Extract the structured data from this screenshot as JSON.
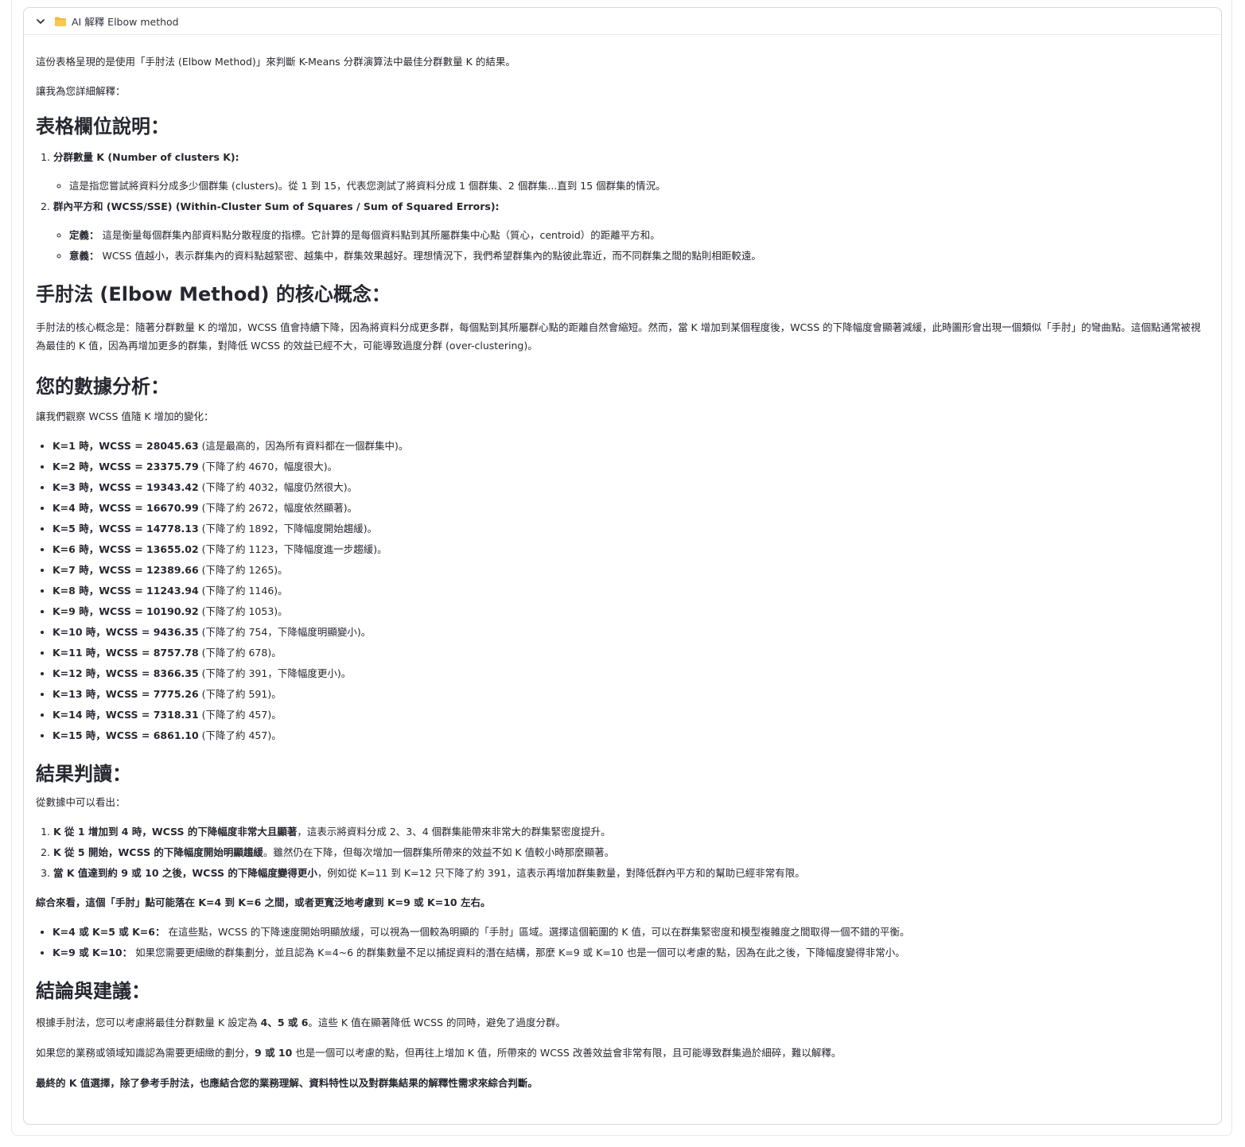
{
  "expander": {
    "title": "AI 解釋 Elbow method",
    "chevron_icon": "chevron-down-icon",
    "folder_icon": "folder-icon"
  },
  "intro": {
    "p1": "這份表格呈現的是使用「手肘法 (Elbow Method)」來判斷 K-Means 分群演算法中最佳分群數量 K 的結果。",
    "p2": "讓我為您詳細解釋："
  },
  "section1": {
    "heading": "表格欄位說明：",
    "item1_title": "分群數量 K (Number of clusters K):",
    "item1_sub": "這是指您嘗試將資料分成多少個群集 (clusters)。從 1 到 15，代表您測試了將資料分成 1 個群集、2 個群集...直到 15 個群集的情況。",
    "item2_title": "群內平方和 (WCSS/SSE) (Within-Cluster Sum of Squares / Sum of Squared Errors):",
    "item2_sub1_label": "定義：",
    "item2_sub1_text": " 這是衡量每個群集內部資料點分散程度的指標。它計算的是每個資料點到其所屬群集中心點（質心，centroid）的距離平方和。",
    "item2_sub2_label": "意義：",
    "item2_sub2_text": " WCSS 值越小，表示群集內的資料點越緊密、越集中，群集效果越好。理想情況下，我們希望群集內的點彼此靠近，而不同群集之間的點則相距較遠。"
  },
  "section2": {
    "heading": "手肘法 (Elbow Method) 的核心概念：",
    "body": "手肘法的核心概念是：隨著分群數量 K 的增加，WCSS 值會持續下降，因為將資料分成更多群，每個點到其所屬群心點的距離自然會縮短。然而，當 K 增加到某個程度後，WCSS 的下降幅度會顯著減緩，此時圖形會出現一個類似「手肘」的彎曲點。這個點通常被視為最佳的 K 值，因為再增加更多的群集，對降低 WCSS 的效益已經不大，可能導致過度分群 (over-clustering)。"
  },
  "section3": {
    "heading": "您的數據分析：",
    "intro": "讓我們觀察 WCSS 值隨 K 增加的變化：",
    "items": [
      {
        "b": "K=1 時，WCSS = 28045.63",
        "t": " (這是最高的，因為所有資料都在一個群集中)。"
      },
      {
        "b": "K=2 時，WCSS = 23375.79",
        "t": " (下降了約 4670，幅度很大)。"
      },
      {
        "b": "K=3 時，WCSS = 19343.42",
        "t": " (下降了約 4032，幅度仍然很大)。"
      },
      {
        "b": "K=4 時，WCSS = 16670.99",
        "t": " (下降了約 2672，幅度依然顯著)。"
      },
      {
        "b": "K=5 時，WCSS = 14778.13",
        "t": " (下降了約 1892，下降幅度開始趨緩)。"
      },
      {
        "b": "K=6 時，WCSS = 13655.02",
        "t": " (下降了約 1123，下降幅度進一步趨緩)。"
      },
      {
        "b": "K=7 時，WCSS = 12389.66",
        "t": " (下降了約 1265)。"
      },
      {
        "b": "K=8 時，WCSS = 11243.94",
        "t": " (下降了約 1146)。"
      },
      {
        "b": "K=9 時，WCSS = 10190.92",
        "t": " (下降了約 1053)。"
      },
      {
        "b": "K=10 時，WCSS = 9436.35",
        "t": " (下降了約 754，下降幅度明顯變小)。"
      },
      {
        "b": "K=11 時，WCSS = 8757.78",
        "t": " (下降了約 678)。"
      },
      {
        "b": "K=12 時，WCSS = 8366.35",
        "t": " (下降了約 391，下降幅度更小)。"
      },
      {
        "b": "K=13 時，WCSS = 7775.26",
        "t": " (下降了約 591)。"
      },
      {
        "b": "K=14 時，WCSS = 7318.31",
        "t": " (下降了約 457)。"
      },
      {
        "b": "K=15 時，WCSS = 6861.10",
        "t": " (下降了約 457)。"
      }
    ]
  },
  "section4": {
    "heading": "結果判讀：",
    "intro": "從數據中可以看出：",
    "ol": [
      {
        "b": "K 從 1 增加到 4 時，WCSS 的下降幅度非常大且顯著",
        "t": "，這表示將資料分成 2、3、4 個群集能帶來非常大的群集緊密度提升。"
      },
      {
        "b": "K 從 5 開始，WCSS 的下降幅度開始明顯趨緩",
        "t": "。雖然仍在下降，但每次增加一個群集所帶來的效益不如 K 值較小時那麼顯著。"
      },
      {
        "b": "當 K 值達到約 9 或 10 之後，WCSS 的下降幅度變得更小",
        "t": "，例如從 K=11 到 K=12 只下降了約 391，這表示再增加群集數量，對降低群內平方和的幫助已經非常有限。"
      }
    ],
    "summary": "綜合來看，這個「手肘」點可能落在 K=4 到 K=6 之間，或者更寬泛地考慮到 K=9 或 K=10 左右。",
    "ul": [
      {
        "b": "K=4 或 K=5 或 K=6：",
        "t": " 在這些點，WCSS 的下降速度開始明顯放緩，可以視為一個較為明顯的「手肘」區域。選擇這個範圍的 K 值，可以在群集緊密度和模型複雜度之間取得一個不錯的平衡。"
      },
      {
        "b": "K=9 或 K=10：",
        "t": " 如果您需要更細緻的群集劃分，並且認為 K=4~6 的群集數量不足以捕捉資料的潛在結構，那麼 K=9 或 K=10 也是一個可以考慮的點，因為在此之後，下降幅度變得非常小。"
      }
    ]
  },
  "section5": {
    "heading": "結論與建議：",
    "p1_a": "根據手肘法，您可以考慮將最佳分群數量 K 設定為 ",
    "p1_b": "4、5 或 6",
    "p1_c": "。這些 K 值在顯著降低 WCSS 的同時，避免了過度分群。",
    "p2_a": "如果您的業務或領域知識認為需要更細緻的劃分，",
    "p2_b": "9 或 10",
    "p2_c": " 也是一個可以考慮的點，但再往上增加 K 值，所帶來的 WCSS 改善效益會非常有限，且可能導致群集過於細碎，難以解釋。",
    "p3": "最終的 K 值選擇，除了參考手肘法，也應結合您的業務理解、資料特性以及對群集結果的解釋性需求來綜合判斷。"
  }
}
